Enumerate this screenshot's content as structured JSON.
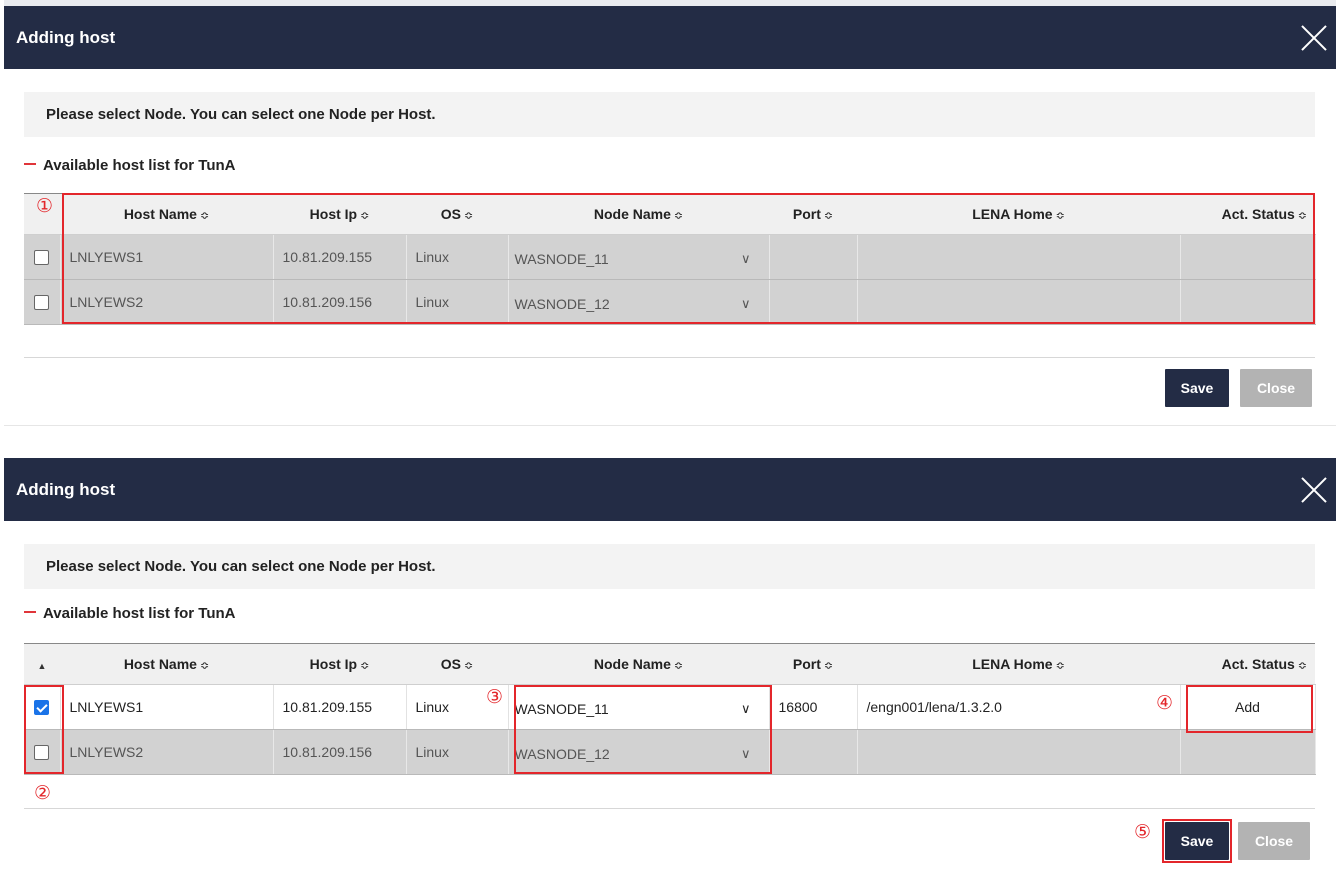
{
  "dialogs": [
    {
      "title": "Adding host",
      "info_text": "Please select Node. You can select one Node per Host.",
      "section_title": "Available host list for TunA",
      "columns": [
        "Host Name",
        "Host Ip",
        "OS",
        "Node Name",
        "Port",
        "LENA Home",
        "Act. Status"
      ],
      "sort_glyph": "≎",
      "first_col_header": "",
      "rows": [
        {
          "checked": false,
          "host_name": "LNLYEWS1",
          "host_ip": "10.81.209.155",
          "os": "Linux",
          "node_name": "WASNODE_11",
          "port": "",
          "lena_home": "",
          "act_status": ""
        },
        {
          "checked": false,
          "host_name": "LNLYEWS2",
          "host_ip": "10.81.209.156",
          "os": "Linux",
          "node_name": "WASNODE_12",
          "port": "",
          "lena_home": "",
          "act_status": ""
        }
      ],
      "save_label": "Save",
      "close_label": "Close"
    },
    {
      "title": "Adding host",
      "info_text": "Please select Node. You can select one Node per Host.",
      "section_title": "Available host list for TunA",
      "columns": [
        "Host Name",
        "Host Ip",
        "OS",
        "Node Name",
        "Port",
        "LENA Home",
        "Act. Status"
      ],
      "sort_glyph": "≎",
      "first_col_header": "▲",
      "rows": [
        {
          "checked": true,
          "host_name": "LNLYEWS1",
          "host_ip": "10.81.209.155",
          "os": "Linux",
          "node_name": "WASNODE_11",
          "port": "16800",
          "lena_home": "/engn001/lena/1.3.2.0",
          "act_status": "Add"
        },
        {
          "checked": false,
          "host_name": "LNLYEWS2",
          "host_ip": "10.81.209.156",
          "os": "Linux",
          "node_name": "WASNODE_12",
          "port": "",
          "lena_home": "",
          "act_status": ""
        }
      ],
      "save_label": "Save",
      "close_label": "Close"
    }
  ],
  "annotations": [
    "①",
    "②",
    "③",
    "④",
    "⑤"
  ],
  "icons": {
    "close": "close-icon",
    "chevron": "chevron-down-icon",
    "sort": "sort-icon",
    "minus": "minus-icon"
  },
  "colors": {
    "header_bg": "#232c45",
    "highlight": "#e3262b",
    "checkbox_on": "#1a73e8"
  }
}
